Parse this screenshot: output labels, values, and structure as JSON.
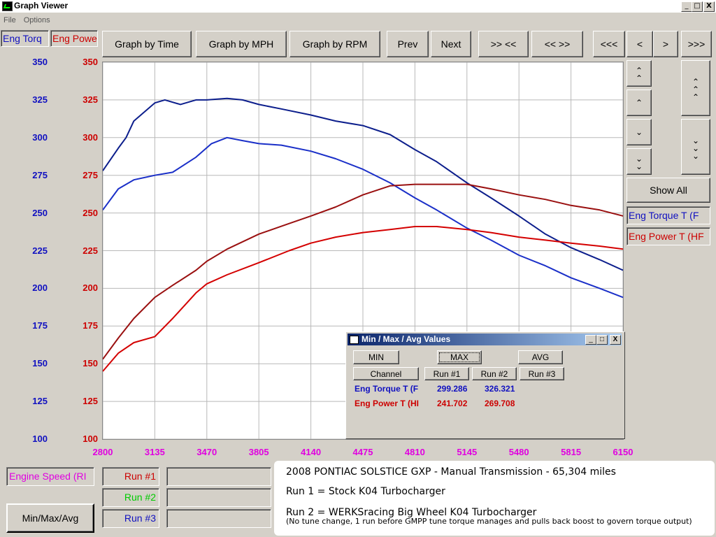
{
  "window": {
    "title": "Graph Viewer",
    "min": "_",
    "max": "□",
    "close": "X"
  },
  "menu": [
    "File",
    "Options"
  ],
  "toolbar": {
    "left_channel_1": "Eng Torq",
    "left_channel_2": "Eng Powe",
    "buttons": [
      "Graph by Time",
      "Graph by MPH",
      "Graph by RPM",
      "Prev",
      "Next",
      ">> <<",
      "<< >>",
      "<<<",
      "<",
      ">",
      ">>>"
    ]
  },
  "scroll": {
    "up_fast": "⌃⌃",
    "up": "⌃",
    "down": "⌄",
    "down_fast": "⌄⌄",
    "right_up": "⌃⌃⌃",
    "right_down": "⌄⌄⌄"
  },
  "right_panel": {
    "show_all": "Show All",
    "channel_1": "Eng Torque T (F",
    "channel_2": "Eng Power T (HF"
  },
  "colors": {
    "torque": "#1010c0",
    "power": "#cc0000",
    "run1_torque": "#1a2fc8",
    "run2_torque": "#0c1e8c",
    "run1_power": "#d40000",
    "run2_power": "#9a1010",
    "xaxis": "#e000e0",
    "run2_legend": "#00cc00"
  },
  "chart_data": {
    "type": "line",
    "x": [
      2800,
      3135,
      3470,
      3805,
      4140,
      4475,
      4810,
      5145,
      5480,
      5815,
      6150
    ],
    "x_ticks": [
      "2800",
      "3135",
      "3470",
      "3805",
      "4140",
      "4475",
      "4810",
      "5145",
      "5480",
      "5815",
      "6150"
    ],
    "y_torque_ticks": [
      "350",
      "325",
      "300",
      "275",
      "250",
      "225",
      "200",
      "175",
      "150",
      "125",
      "100"
    ],
    "y_power_ticks": [
      "350",
      "325",
      "300",
      "275",
      "250",
      "225",
      "200",
      "175",
      "150",
      "125",
      "100"
    ],
    "ylim": [
      100,
      350
    ],
    "xlim": [
      2800,
      6150
    ],
    "grid": true,
    "series": [
      {
        "name": "Run #1",
        "channel": "torque",
        "x": [
          2800,
          2900,
          3000,
          3135,
          3250,
          3400,
          3500,
          3600,
          3700,
          3805,
          3950,
          4140,
          4300,
          4475,
          4650,
          4810,
          4950,
          5145,
          5300,
          5480,
          5650,
          5815,
          6000,
          6150
        ],
        "values": [
          252,
          266,
          272,
          275,
          277,
          287,
          296,
          300,
          298,
          296,
          295,
          291,
          286,
          279,
          270,
          260,
          252,
          240,
          232,
          222,
          215,
          207,
          200,
          194
        ]
      },
      {
        "name": "Run #2",
        "channel": "torque",
        "x": [
          2800,
          2900,
          2950,
          3000,
          3135,
          3200,
          3300,
          3400,
          3470,
          3600,
          3700,
          3805,
          3950,
          4140,
          4300,
          4475,
          4650,
          4810,
          4950,
          5145,
          5300,
          5480,
          5650,
          5815,
          6000,
          6150
        ],
        "values": [
          278,
          293,
          300,
          311,
          323,
          325,
          322,
          325,
          325,
          326,
          325,
          322,
          319,
          315,
          311,
          308,
          302,
          292,
          284,
          270,
          260,
          248,
          236,
          227,
          219,
          212
        ]
      },
      {
        "name": "Run #1",
        "channel": "power",
        "x": [
          2800,
          2900,
          3000,
          3135,
          3250,
          3400,
          3470,
          3600,
          3805,
          4000,
          4140,
          4300,
          4475,
          4650,
          4810,
          4950,
          5145,
          5300,
          5480,
          5650,
          5815,
          6000,
          6150
        ],
        "values": [
          145,
          157,
          164,
          168,
          180,
          197,
          203,
          209,
          217,
          225,
          230,
          234,
          237,
          239,
          241,
          241,
          239,
          237,
          234,
          232,
          230,
          228,
          226
        ]
      },
      {
        "name": "Run #2",
        "channel": "power",
        "x": [
          2800,
          2900,
          3000,
          3135,
          3250,
          3400,
          3470,
          3600,
          3805,
          4000,
          4140,
          4300,
          4475,
          4650,
          4810,
          4950,
          5145,
          5300,
          5480,
          5650,
          5815,
          6000,
          6150
        ],
        "values": [
          153,
          167,
          180,
          194,
          202,
          212,
          218,
          226,
          236,
          243,
          248,
          254,
          262,
          268,
          269,
          269,
          269,
          266,
          262,
          259,
          255,
          252,
          248
        ]
      }
    ]
  },
  "dialog": {
    "title": "Min / Max / Avg Values",
    "min": "MIN",
    "max": "MAX",
    "avg": "AVG",
    "headers": [
      "Channel",
      "Run #1",
      "Run #2",
      "Run #3"
    ],
    "rows": [
      {
        "channel": "Eng Torque T (F",
        "run1": "299.286",
        "run2": "326.321"
      },
      {
        "channel": "Eng Power T (HI",
        "run1": "241.702",
        "run2": "269.708"
      }
    ]
  },
  "bottom": {
    "xaxis_channel": "Engine Speed (RI",
    "run1": "Run #1",
    "run2": "Run #2",
    "run3": "Run #3",
    "minmax_button": "Min/Max/Avg"
  },
  "info": {
    "line1": "2008 PONTIAC SOLSTICE GXP - Manual Transmission - 65,304 miles",
    "line2": "Run 1 = Stock K04 Turbocharger",
    "line3": "Run 2 = WERKSracing Big Wheel K04 Turbocharger",
    "line4": "(No tune change, 1 run before GMPP tune torque manages and pulls back boost to govern torque output)"
  }
}
